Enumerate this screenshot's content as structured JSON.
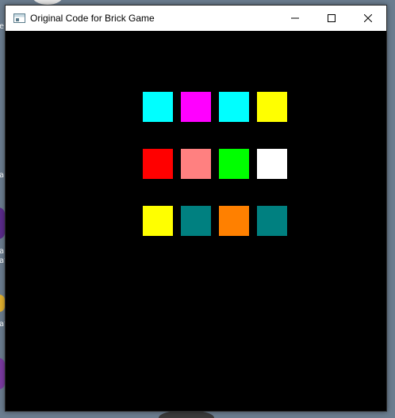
{
  "window": {
    "title": "Original Code for Brick Game",
    "icon": "window-app-icon",
    "controls": [
      {
        "name": "minimize-button",
        "icon": "minimize-icon"
      },
      {
        "name": "maximize-button",
        "icon": "maximize-icon"
      },
      {
        "name": "close-button",
        "icon": "close-icon"
      }
    ]
  },
  "game": {
    "background": "#000000",
    "bricks": [
      [
        "#00ffff",
        "#ff00ff",
        "#00ffff",
        "#ffff00"
      ],
      [
        "#ff0000",
        "#ff8080",
        "#00ff00",
        "#ffffff"
      ],
      [
        "#ffff00",
        "#008080",
        "#ff8000",
        "#008080"
      ]
    ]
  },
  "desktop": {
    "fragments": [
      "e",
      "a",
      "a",
      "at",
      "at"
    ]
  }
}
